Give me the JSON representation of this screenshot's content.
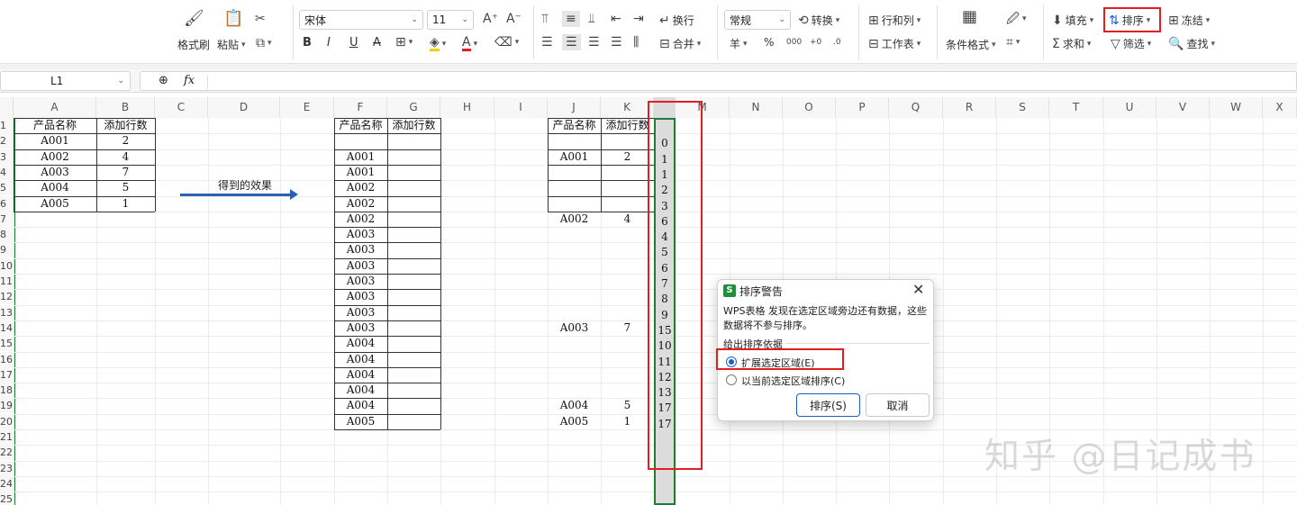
{
  "ribbon": {
    "clipboard": {
      "format_painter": "格式刷",
      "paste": "粘贴"
    },
    "font": {
      "name": "宋体",
      "size": "11",
      "bold": "B",
      "italic": "I",
      "underline": "U",
      "strike": "A"
    },
    "align": {
      "wrap": "换行",
      "merge": "合并"
    },
    "number": {
      "format": "常规",
      "convert": "转换",
      "currency": "羊",
      "percent": "%"
    },
    "cells": {
      "row_col": "行和列",
      "worksheet": "工作表"
    },
    "cond_format": "条件格式",
    "edit": {
      "fill": "填充",
      "sort": "排序",
      "freeze": "冻结",
      "sum": "求和",
      "filter": "筛选",
      "find": "查找"
    }
  },
  "formula_bar": {
    "name_box": "L1",
    "fx": "fx"
  },
  "columns": [
    "A",
    "B",
    "C",
    "D",
    "E",
    "F",
    "G",
    "H",
    "I",
    "J",
    "K",
    "L",
    "M",
    "N",
    "O",
    "P",
    "Q",
    "R",
    "S",
    "T",
    "U",
    "V",
    "W",
    "X"
  ],
  "row_numbers": [
    "1",
    "2",
    "3",
    "4",
    "5",
    "6",
    "7",
    "8",
    "9",
    "10",
    "11",
    "12",
    "13",
    "14",
    "15",
    "16",
    "17",
    "18",
    "19",
    "20",
    "21",
    "22",
    "23",
    "24",
    "25"
  ],
  "table1": {
    "headers": [
      "产品名称",
      "添加行数"
    ],
    "rows": [
      [
        "A001",
        "2"
      ],
      [
        "A002",
        "4"
      ],
      [
        "A003",
        "7"
      ],
      [
        "A004",
        "5"
      ],
      [
        "A005",
        "1"
      ]
    ]
  },
  "arrow_label": "得到的效果",
  "table2": {
    "headers": [
      "产品名称",
      "添加行数"
    ],
    "col_f": [
      "A001",
      "A001",
      "A002",
      "A002",
      "A002",
      "A003",
      "A003",
      "A003",
      "A003",
      "A003",
      "A003",
      "A003",
      "A004",
      "A004",
      "A004",
      "A004",
      "A004",
      "A005"
    ]
  },
  "table3": {
    "headers": [
      "产品名称",
      "添加行数"
    ],
    "entries": [
      {
        "row": 3,
        "name": "A001",
        "count": "2"
      },
      {
        "row": 7,
        "name": "A002",
        "count": "4"
      },
      {
        "row": 14,
        "name": "A003",
        "count": "7"
      },
      {
        "row": 19,
        "name": "A004",
        "count": "5"
      },
      {
        "row": 20,
        "name": "A005",
        "count": "1"
      }
    ]
  },
  "col_l_values": [
    "0",
    "1",
    "1",
    "2",
    "3",
    "6",
    "4",
    "5",
    "6",
    "7",
    "8",
    "9",
    "15",
    "10",
    "11",
    "12",
    "13",
    "17",
    "17"
  ],
  "dialog": {
    "app_icon": "S",
    "title": "排序警告",
    "message": "WPS表格 发现在选定区域旁边还有数据，这些数据将不参与排序。",
    "group_label": "给出排序依据",
    "option_expand": "扩展选定区域(E)",
    "option_current": "以当前选定区域排序(C)",
    "sort_button": "排序(S)",
    "cancel_button": "取消"
  },
  "watermark": "知乎 @日记成书",
  "colors": {
    "accent_red": "#e02020",
    "selection_green": "#1e7d32",
    "dialog_blue": "#1a5fc4"
  }
}
